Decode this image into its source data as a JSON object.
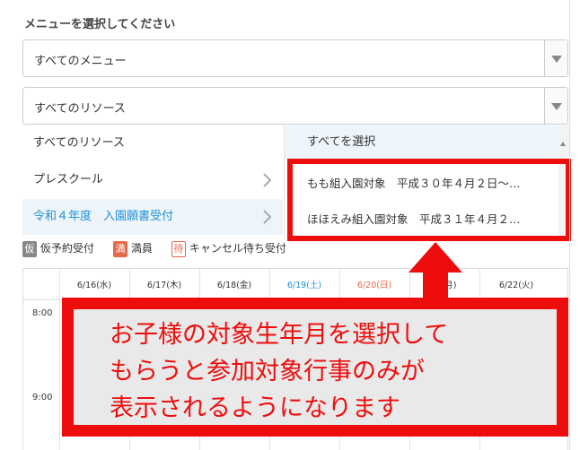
{
  "menu_label": "メニューを選択してください",
  "menu_select": {
    "value": "すべてのメニュー"
  },
  "resource_select": {
    "value": "すべてのリソース"
  },
  "dropdown_left": {
    "items": [
      {
        "label": "すべてのリソース"
      },
      {
        "label": "プレスクール"
      },
      {
        "label": "令和４年度　入園願書受付"
      }
    ]
  },
  "dropdown_right": {
    "header": "すべてを選択",
    "items": [
      {
        "label": "もも組入園対象　平成３０年４月２日〜…"
      },
      {
        "label": "ほほえみ組入園対象　平成３１年４月２…"
      }
    ]
  },
  "legend": {
    "prov_badge": "仮",
    "prov_label": "仮予約受付",
    "full_badge": "満",
    "full_label": "満員",
    "wait_badge": "待",
    "wait_label": "キャンセル待ち受付"
  },
  "calendar": {
    "days": [
      {
        "label": "6/16(水)",
        "kind": "weekday"
      },
      {
        "label": "6/17(木)",
        "kind": "weekday"
      },
      {
        "label": "6/18(金)",
        "kind": "weekday"
      },
      {
        "label": "6/19(土)",
        "kind": "sat"
      },
      {
        "label": "6/20(日)",
        "kind": "sun"
      },
      {
        "label": "1(月)",
        "kind": "weekday"
      },
      {
        "label": "6/22(火)",
        "kind": "weekday"
      }
    ],
    "times": [
      "8:00",
      "9:00"
    ]
  },
  "callout": {
    "lines": [
      "お子様の対象生年月を選択して",
      "もらうと参加対象行事のみが",
      "表示されるようになります"
    ]
  },
  "colors": {
    "highlight_red": "#ee0d0d",
    "accent_blue": "#1e90d6",
    "sunday": "#e8684a"
  },
  "icons": {
    "chevron": "chevron-right-icon",
    "dropdown": "chevron-down-icon"
  }
}
